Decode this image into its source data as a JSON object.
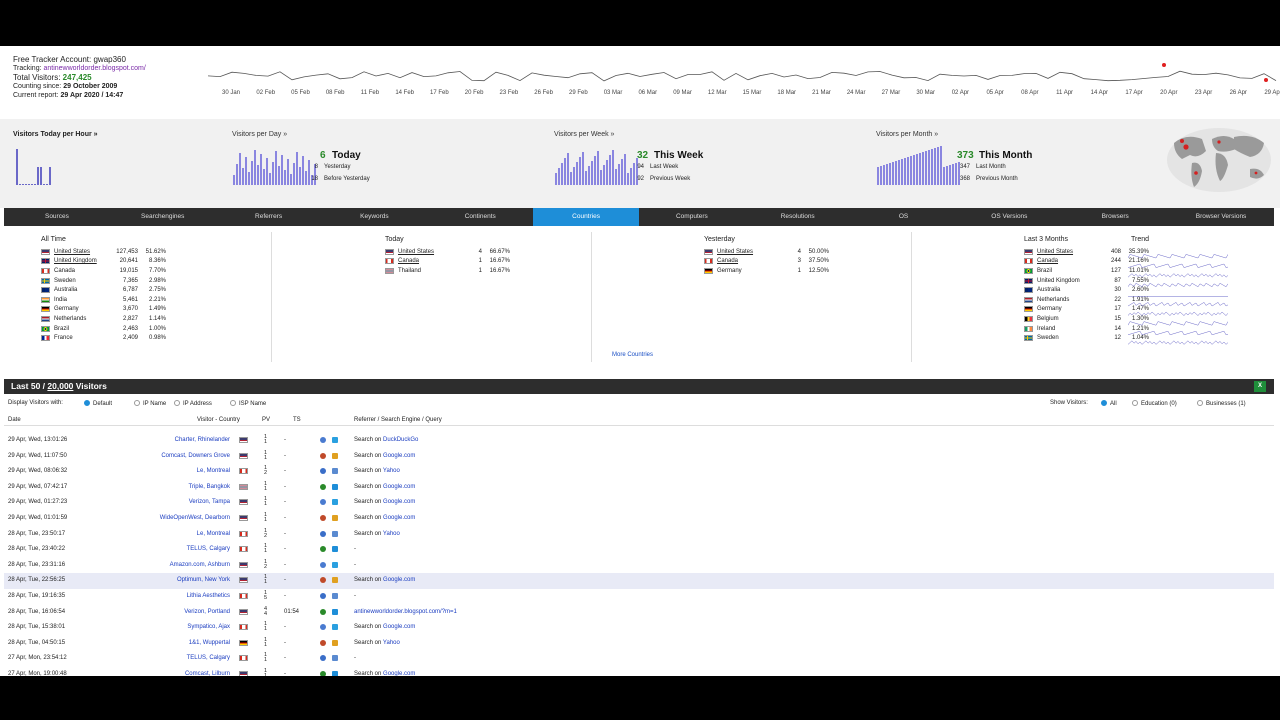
{
  "header": {
    "account": "Free Tracker Account: gwap360",
    "tracking_label": "Tracking:",
    "tracking_url": "antinewworldorder.blogspot.com/",
    "total_label": "Total Visitors:",
    "total_value": "247,425",
    "since_label": "Counting since:",
    "since_value": "29 October 2009",
    "report_label": "Current report:",
    "report_value": "29 Apr 2020  /  14:47",
    "timeline_dates": [
      "30 Jan",
      "02 Feb",
      "05 Feb",
      "08 Feb",
      "11 Feb",
      "14 Feb",
      "17 Feb",
      "20 Feb",
      "23 Feb",
      "26 Feb",
      "29 Feb",
      "03 Mar",
      "06 Mar",
      "09 Mar",
      "12 Mar",
      "15 Mar",
      "18 Mar",
      "21 Mar",
      "24 Mar",
      "27 Mar",
      "30 Mar",
      "02 Apr",
      "05 Apr",
      "08 Apr",
      "11 Apr",
      "14 Apr",
      "17 Apr",
      "20 Apr",
      "23 Apr",
      "26 Apr",
      "29 Apr"
    ]
  },
  "stats": {
    "hour_title": "Visitors Today per Hour »",
    "day_title": "Visitors per Day »",
    "week_title": "Visitors per Week »",
    "month_title": "Visitors per Month »",
    "today_num": "6",
    "today_label": "Today",
    "yesterday_num": "8",
    "yesterday_label": "Yesterday",
    "before_num": "18",
    "before_label": "Before Yesterday",
    "week_num": "32",
    "week_label": "This Week",
    "lastweek_num": "94",
    "lastweek_label": "Last Week",
    "prevweek_num": "92",
    "prevweek_label": "Previous Week",
    "month_num": "373",
    "month_label": "This Month",
    "lastmonth_num": "347",
    "lastmonth_label": "Last Month",
    "prevmonth_num": "368",
    "prevmonth_label": "Previous Month"
  },
  "tabs": [
    "Sources",
    "Searchengines",
    "Referrers",
    "Keywords",
    "Continents",
    "Countries",
    "Computers",
    "Resolutions",
    "OS",
    "OS Versions",
    "Browsers",
    "Browser Versions"
  ],
  "countries": {
    "alltime_title": "All Time",
    "alltime": [
      {
        "name": "United States",
        "value": "127,453",
        "pct": "51.62%",
        "flag": "us"
      },
      {
        "name": "United Kingdom",
        "value": "20,641",
        "pct": "8.36%",
        "flag": "uk"
      },
      {
        "name": "Canada",
        "value": "19,015",
        "pct": "7.70%",
        "flag": "ca"
      },
      {
        "name": "Sweden",
        "value": "7,365",
        "pct": "2.98%",
        "flag": "se"
      },
      {
        "name": "Australia",
        "value": "6,787",
        "pct": "2.75%",
        "flag": "au"
      },
      {
        "name": "India",
        "value": "5,461",
        "pct": "2.21%",
        "flag": "in"
      },
      {
        "name": "Germany",
        "value": "3,670",
        "pct": "1.49%",
        "flag": "de"
      },
      {
        "name": "Netherlands",
        "value": "2,827",
        "pct": "1.14%",
        "flag": "nl"
      },
      {
        "name": "Brazil",
        "value": "2,463",
        "pct": "1.00%",
        "flag": "br"
      },
      {
        "name": "France",
        "value": "2,409",
        "pct": "0.98%",
        "flag": "fr"
      }
    ],
    "today_title": "Today",
    "today": [
      {
        "name": "United States",
        "value": "4",
        "pct": "66.67%",
        "flag": "us"
      },
      {
        "name": "Canada",
        "value": "1",
        "pct": "16.67%",
        "flag": "ca"
      },
      {
        "name": "Thailand",
        "value": "1",
        "pct": "16.67%",
        "flag": "th"
      }
    ],
    "yesterday_title": "Yesterday",
    "yesterday": [
      {
        "name": "United States",
        "value": "4",
        "pct": "50.00%",
        "flag": "us"
      },
      {
        "name": "Canada",
        "value": "3",
        "pct": "37.50%",
        "flag": "ca"
      },
      {
        "name": "Germany",
        "value": "1",
        "pct": "12.50%",
        "flag": "de"
      }
    ],
    "last3_title": "Last 3 Months",
    "trend_title": "Trend",
    "last3": [
      {
        "name": "United States",
        "value": "408",
        "pct": "35.39%",
        "flag": "us"
      },
      {
        "name": "Canada",
        "value": "244",
        "pct": "21.16%",
        "flag": "ca"
      },
      {
        "name": "Brazil",
        "value": "127",
        "pct": "11.01%",
        "flag": "br"
      },
      {
        "name": "United Kingdom",
        "value": "87",
        "pct": "7.55%",
        "flag": "uk"
      },
      {
        "name": "Australia",
        "value": "30",
        "pct": "2.60%",
        "flag": "au"
      },
      {
        "name": "Netherlands",
        "value": "22",
        "pct": "1.91%",
        "flag": "nl"
      },
      {
        "name": "Germany",
        "value": "17",
        "pct": "1.47%",
        "flag": "de"
      },
      {
        "name": "Belgium",
        "value": "15",
        "pct": "1.30%",
        "flag": "be"
      },
      {
        "name": "Ireland",
        "value": "14",
        "pct": "1.21%",
        "flag": "ie"
      },
      {
        "name": "Sweden",
        "value": "12",
        "pct": "1.04%",
        "flag": "se"
      }
    ],
    "more_label": "More Countries"
  },
  "visitors": {
    "bar_prefix": "Last 50 /",
    "bar_count": "20,000",
    "bar_suffix": "Visitors",
    "display_label": "Display Visitors with:",
    "display_opts": [
      "Default",
      "IP Name",
      "IP Address",
      "ISP Name"
    ],
    "show_label": "Show Visitors:",
    "show_opts": [
      "All",
      "Education (0)",
      "Businesses (1)"
    ],
    "cols": {
      "date": "Date",
      "visitor": "Visitor - Country",
      "pv": "PV",
      "ts": "TS",
      "ref": "Referrer / Search Engine / Query"
    },
    "rows": [
      {
        "date": "29 Apr, Wed, 13:01:26",
        "visitor": "Charter, Rhinelander",
        "flag": "us",
        "pv": "1\n1",
        "ts": "-",
        "ref_prefix": "Search on ",
        "ref_link": "DuckDuckGo"
      },
      {
        "date": "29 Apr, Wed, 11:07:50",
        "visitor": "Comcast, Downers Grove",
        "flag": "us",
        "pv": "1\n1",
        "ts": "-",
        "ref_prefix": "Search on ",
        "ref_link": "Google.com"
      },
      {
        "date": "29 Apr, Wed, 08:06:32",
        "visitor": "Le, Montreal",
        "flag": "ca",
        "pv": "1\n2",
        "ts": "-",
        "ref_prefix": "Search on ",
        "ref_link": "Yahoo"
      },
      {
        "date": "29 Apr, Wed, 07:42:17",
        "visitor": "Triple, Bangkok",
        "flag": "th",
        "pv": "1\n1",
        "ts": "-",
        "ref_prefix": "Search on ",
        "ref_link": "Google.com"
      },
      {
        "date": "29 Apr, Wed, 01:27:23",
        "visitor": "Verizon, Tampa",
        "flag": "us",
        "pv": "1\n1",
        "ts": "-",
        "ref_prefix": "Search on ",
        "ref_link": "Google.com"
      },
      {
        "date": "29 Apr, Wed, 01:01:59",
        "visitor": "WideOpenWest, Dearborn",
        "flag": "us",
        "pv": "1\n1",
        "ts": "-",
        "ref_prefix": "Search on ",
        "ref_link": "Google.com"
      },
      {
        "date": "28 Apr, Tue, 23:50:17",
        "visitor": "Le, Montreal",
        "flag": "ca",
        "pv": "1\n2",
        "ts": "-",
        "ref_prefix": "Search on ",
        "ref_link": "Yahoo"
      },
      {
        "date": "28 Apr, Tue, 23:40:22",
        "visitor": "TELUS, Calgary",
        "flag": "ca",
        "pv": "1\n1",
        "ts": "-",
        "ref_prefix": "-",
        "ref_link": ""
      },
      {
        "date": "28 Apr, Tue, 23:31:16",
        "visitor": "Amazon.com, Ashburn",
        "flag": "us",
        "pv": "1\n2",
        "ts": "-",
        "ref_prefix": "-",
        "ref_link": ""
      },
      {
        "date": "28 Apr, Tue, 22:56:25",
        "visitor": "Optimum, New York",
        "flag": "us",
        "pv": "1\n1",
        "ts": "-",
        "ref_prefix": "Search on ",
        "ref_link": "Google.com"
      },
      {
        "date": "28 Apr, Tue, 19:16:35",
        "visitor": "Lithia Aesthetics",
        "flag": "ca",
        "pv": "1\n5",
        "ts": "-",
        "ref_prefix": "-",
        "ref_link": ""
      },
      {
        "date": "28 Apr, Tue, 16:06:54",
        "visitor": "Verizon, Portland",
        "flag": "us",
        "pv": "4\n4",
        "ts": "01:54",
        "ref_prefix": "",
        "ref_link": "antinewworldorder.blogspot.com/?m=1"
      },
      {
        "date": "28 Apr, Tue, 15:38:01",
        "visitor": "Sympatico, Ajax",
        "flag": "ca",
        "pv": "1\n1",
        "ts": "-",
        "ref_prefix": "Search on ",
        "ref_link": "Google.com"
      },
      {
        "date": "28 Apr, Tue, 04:50:15",
        "visitor": "1&1, Wuppertal",
        "flag": "de",
        "pv": "1\n1",
        "ts": "-",
        "ref_prefix": "Search on ",
        "ref_link": "Yahoo"
      },
      {
        "date": "27 Apr, Mon, 23:54:12",
        "visitor": "TELUS, Calgary",
        "flag": "ca",
        "pv": "1\n1",
        "ts": "-",
        "ref_prefix": "-",
        "ref_link": ""
      },
      {
        "date": "27 Apr, Mon, 19:00:48",
        "visitor": "Comcast, Lilburn",
        "flag": "us",
        "pv": "1\n1",
        "ts": "-",
        "ref_prefix": "Search on ",
        "ref_link": "Google.com"
      }
    ]
  },
  "colors": {
    "accent": "#1e8ed8",
    "bars": "#8a86e0",
    "link": "#1a3cc0",
    "green": "#2a8a2a"
  }
}
